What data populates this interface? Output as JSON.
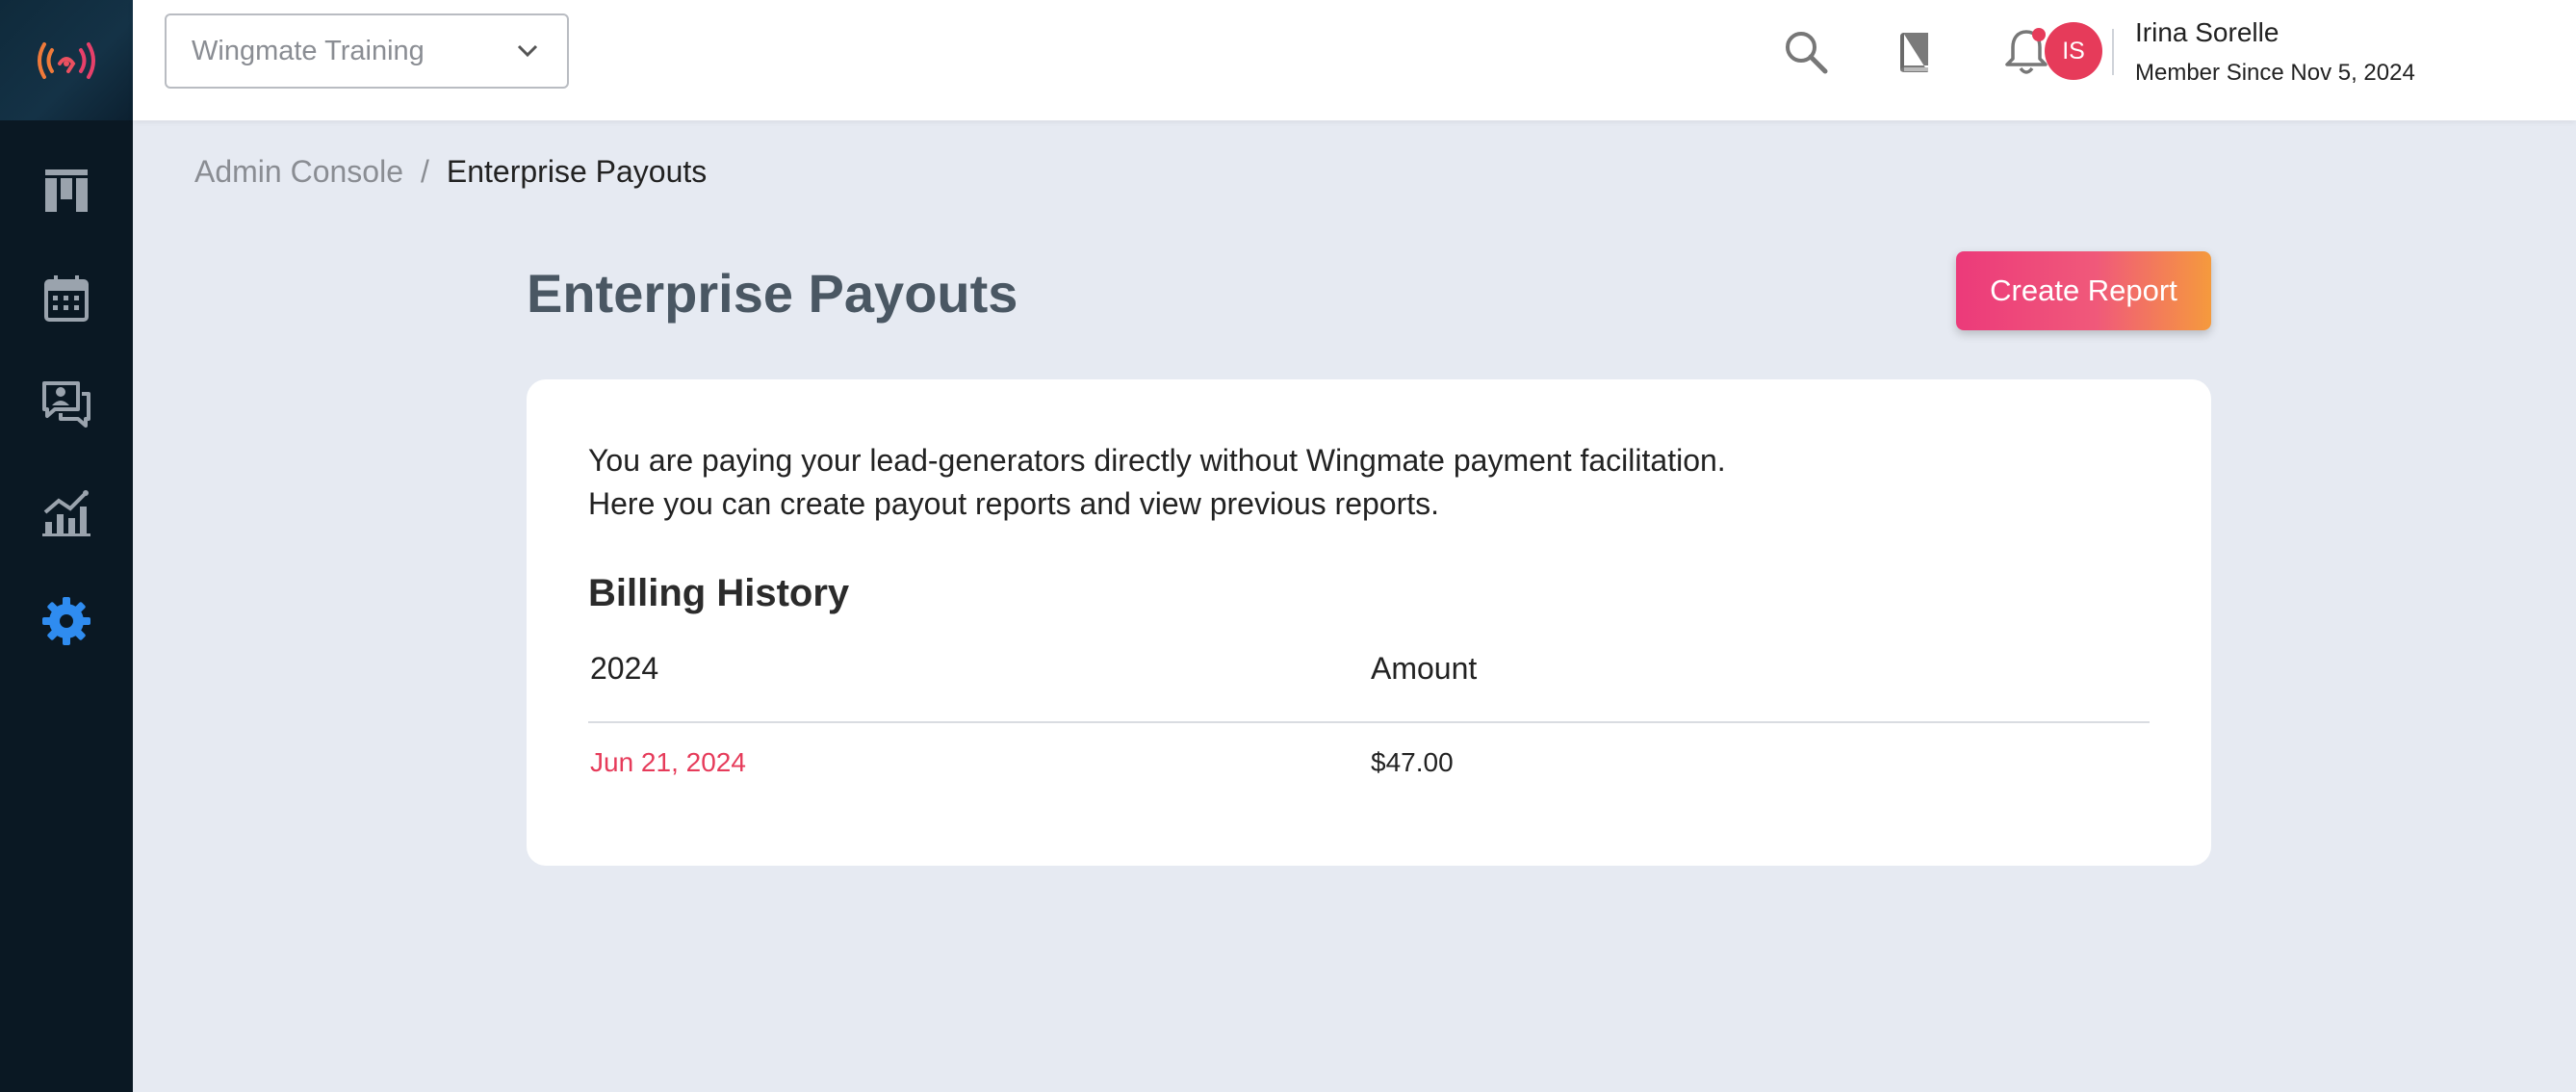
{
  "colors": {
    "sidebar_bg": "#0a1823",
    "accent_red": "#e63b5a",
    "settings_active": "#2f8cf0",
    "page_bg": "#e6eaf2"
  },
  "sidebar": {
    "logo_icon": "broadcast-signal-logo",
    "items": [
      {
        "icon": "board-columns-icon",
        "active": false
      },
      {
        "icon": "calendar-icon",
        "active": false
      },
      {
        "icon": "chat-person-icon",
        "active": false
      },
      {
        "icon": "analytics-chart-icon",
        "active": false
      },
      {
        "icon": "gear-icon",
        "active": true
      }
    ]
  },
  "header": {
    "org_select": {
      "value": "Wingmate Training"
    },
    "icons": [
      "search-icon",
      "book-icon",
      "bell-icon"
    ],
    "user": {
      "initials": "IS",
      "name": "Irina Sorelle",
      "member_since": "Member Since Nov 5, 2024"
    }
  },
  "breadcrumb": {
    "parent": "Admin Console",
    "separator": "/",
    "current": "Enterprise Payouts"
  },
  "page": {
    "title": "Enterprise Payouts",
    "create_button": "Create Report",
    "description_line1": "You are paying your lead-generators directly without Wingmate payment facilitation.",
    "description_line2": "Here you can create payout reports and view previous reports.",
    "billing": {
      "title": "Billing History",
      "columns": [
        "2024",
        "Amount"
      ],
      "rows": [
        {
          "date": "Jun 21, 2024",
          "amount": "$47.00"
        }
      ]
    }
  }
}
